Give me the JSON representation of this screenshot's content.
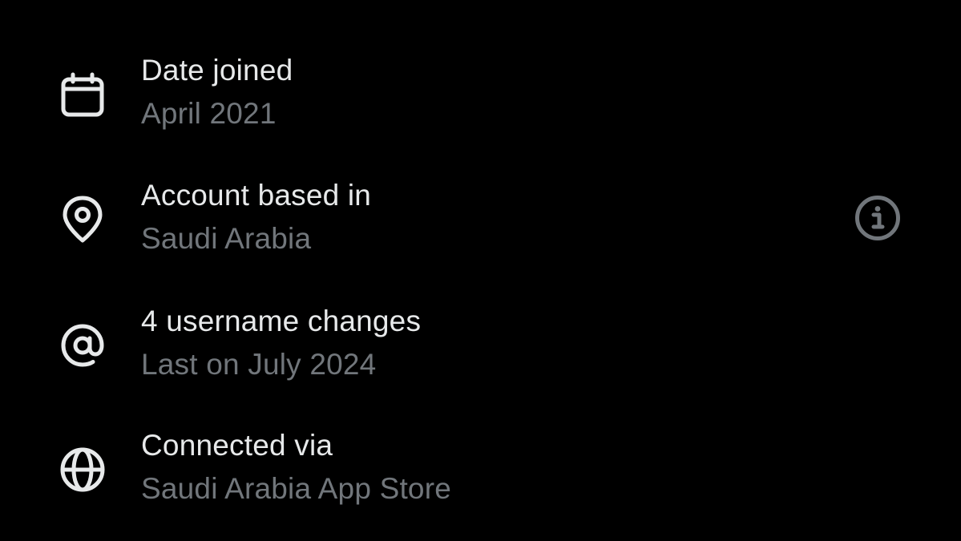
{
  "rows": [
    {
      "title": "Date joined",
      "subtitle": "April 2021",
      "icon": "calendar-icon"
    },
    {
      "title": "Account based in",
      "subtitle": "Saudi Arabia",
      "icon": "location-pin-icon",
      "action_icon": "info-icon"
    },
    {
      "title": "4 username changes",
      "subtitle": "Last on July 2024",
      "icon": "at-sign-icon"
    },
    {
      "title": "Connected via",
      "subtitle": "Saudi Arabia App Store",
      "icon": "globe-icon"
    }
  ],
  "colors": {
    "background": "#000000",
    "primary_text": "#e7e9ea",
    "secondary_text": "#71767b",
    "icon": "#e7e9ea",
    "info_icon": "#71767b"
  }
}
